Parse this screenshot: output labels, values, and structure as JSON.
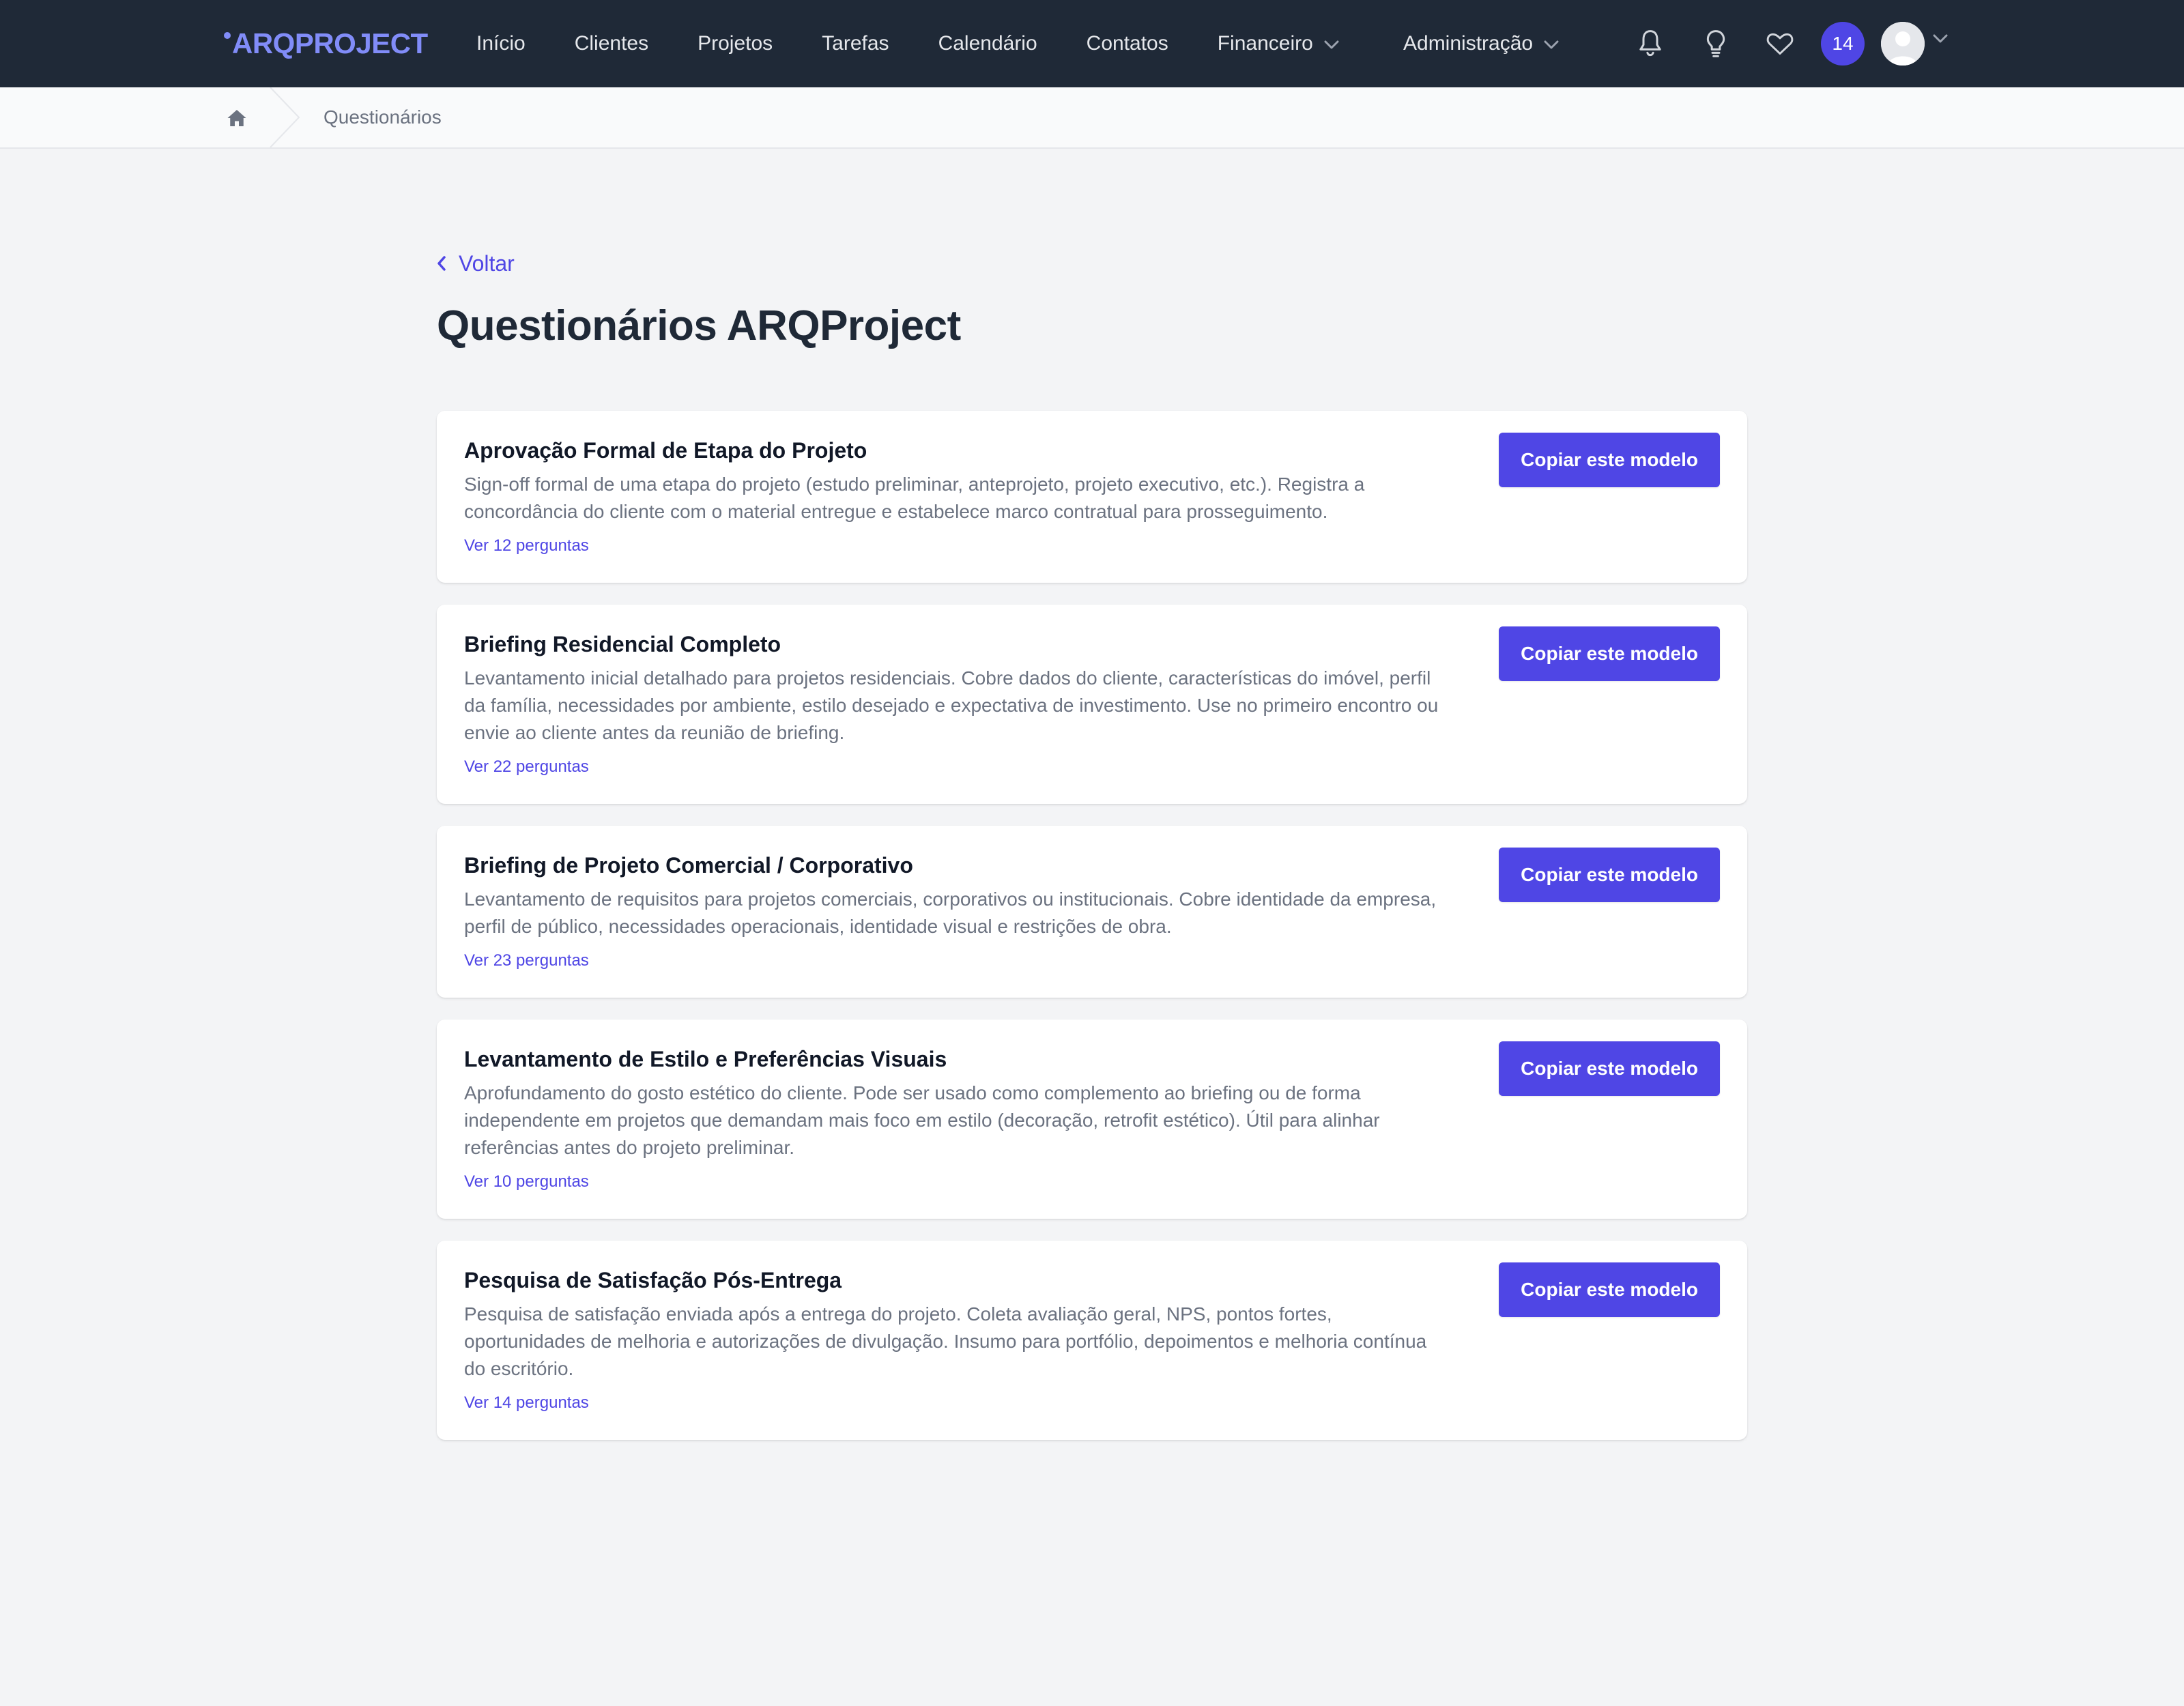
{
  "header": {
    "logo": "ARQPROJECT",
    "nav": [
      {
        "label": "Início"
      },
      {
        "label": "Clientes"
      },
      {
        "label": "Projetos"
      },
      {
        "label": "Tarefas"
      },
      {
        "label": "Calendário"
      },
      {
        "label": "Contatos"
      },
      {
        "label": "Financeiro",
        "dropdown": true
      }
    ],
    "admin_label": "Administração",
    "icons": [
      "bell-icon",
      "lightbulb-icon",
      "heart-icon"
    ],
    "notification_count": "14"
  },
  "breadcrumb": {
    "home_icon": "home-icon",
    "current": "Questionários"
  },
  "main": {
    "back_label": "Voltar",
    "title": "Questionários ARQProject",
    "copy_button_label": "Copiar este modelo",
    "cards": [
      {
        "title": "Aprovação Formal de Etapa do Projeto",
        "description": "Sign-off formal de uma etapa do projeto (estudo preliminar, anteprojeto, projeto executivo, etc.). Registra a concordância do cliente com o material entregue e estabelece marco contratual para prosseguimento.",
        "link": "Ver 12 perguntas"
      },
      {
        "title": "Briefing Residencial Completo",
        "description": "Levantamento inicial detalhado para projetos residenciais. Cobre dados do cliente, características do imóvel, perfil da família, necessidades por ambiente, estilo desejado e expectativa de investimento. Use no primeiro encontro ou envie ao cliente antes da reunião de briefing.",
        "link": "Ver 22 perguntas"
      },
      {
        "title": "Briefing de Projeto Comercial / Corporativo",
        "description": "Levantamento de requisitos para projetos comerciais, corporativos ou institucionais. Cobre identidade da empresa, perfil de público, necessidades operacionais, identidade visual e restrições de obra.",
        "link": "Ver 23 perguntas"
      },
      {
        "title": "Levantamento de Estilo e Preferências Visuais",
        "description": "Aprofundamento do gosto estético do cliente. Pode ser usado como complemento ao briefing ou de forma independente em projetos que demandam mais foco em estilo (decoração, retrofit estético). Útil para alinhar referências antes do projeto preliminar.",
        "link": "Ver 10 perguntas"
      },
      {
        "title": "Pesquisa de Satisfação Pós-Entrega",
        "description": "Pesquisa de satisfação enviada após a entrega do projeto. Coleta avaliação geral, NPS, pontos fortes, oportunidades de melhoria e autorizações de divulgação. Insumo para portfólio, depoimentos e melhoria contínua do escritório.",
        "link": "Ver 14 perguntas"
      }
    ]
  },
  "colors": {
    "navbar": "#1f2937",
    "accent": "#4f46e5",
    "background": "#f3f4f6"
  }
}
